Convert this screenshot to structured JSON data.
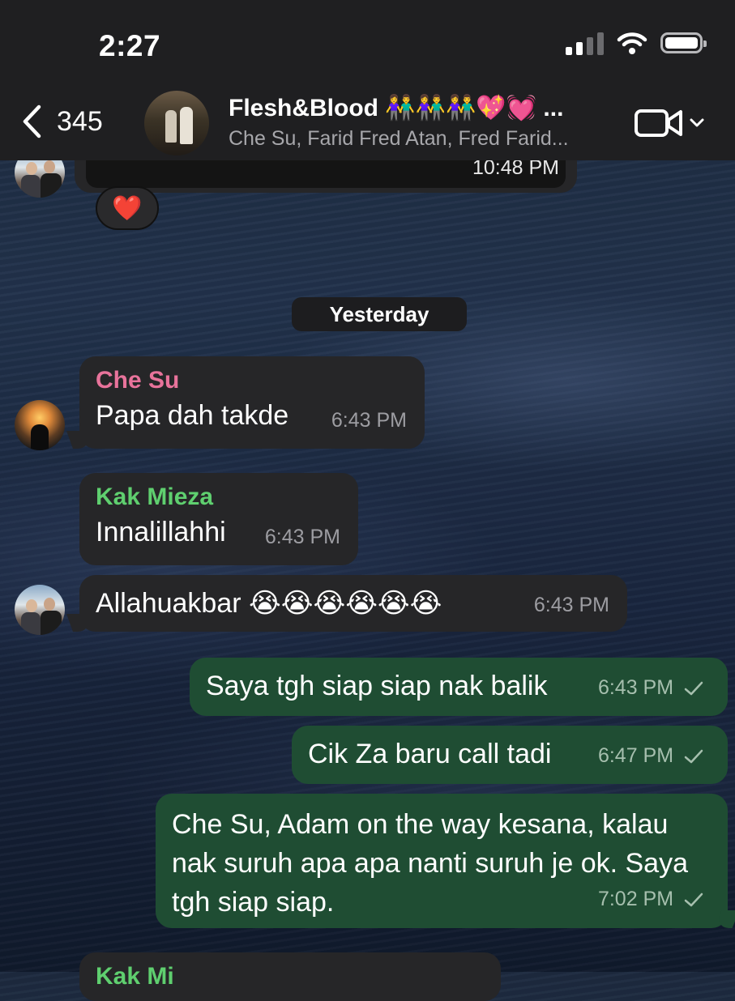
{
  "status_bar": {
    "time": "2:27"
  },
  "header": {
    "back_count": "345",
    "group_name": "Flesh&Blood 👫👫👫💖💓 ...",
    "members": "Che Su, Farid Fred Atan, Fred Farid...",
    "icons": [
      "chevron-left-icon",
      "video-camera-icon",
      "chevron-down-icon"
    ]
  },
  "partial_message": {
    "time": "10:48 PM",
    "reaction": "❤️"
  },
  "date_divider": "Yesterday",
  "messages": [
    {
      "sender": "Che Su",
      "sender_color": "#e8739b",
      "text": "Papa dah takde",
      "time": "6:43 PM",
      "direction": "in"
    },
    {
      "sender": "Kak Mieza",
      "sender_color": "#5fcf6f",
      "text": "Innalillahhi",
      "time": "6:43 PM",
      "direction": "in"
    },
    {
      "text": "Allahuakbar 😭😭😭😭😭😭",
      "time": "6:43 PM",
      "direction": "in"
    },
    {
      "text": "Saya tgh siap siap nak balik",
      "time": "6:43 PM",
      "direction": "out"
    },
    {
      "text": "Cik Za baru call tadi",
      "time": "6:47 PM",
      "direction": "out"
    },
    {
      "text": "Che Su, Adam on the way kesana, kalau nak suruh apa apa nanti suruh je ok. Saya tgh siap siap.",
      "time": "7:02 PM",
      "direction": "out"
    },
    {
      "sender": "Kak Mi",
      "sender_color": "#5fcf6f",
      "direction": "in"
    }
  ],
  "colors": {
    "incoming_bubble": "#262628",
    "outgoing_bubble": "#1f4d33",
    "header_bg": "#1f1f21"
  }
}
